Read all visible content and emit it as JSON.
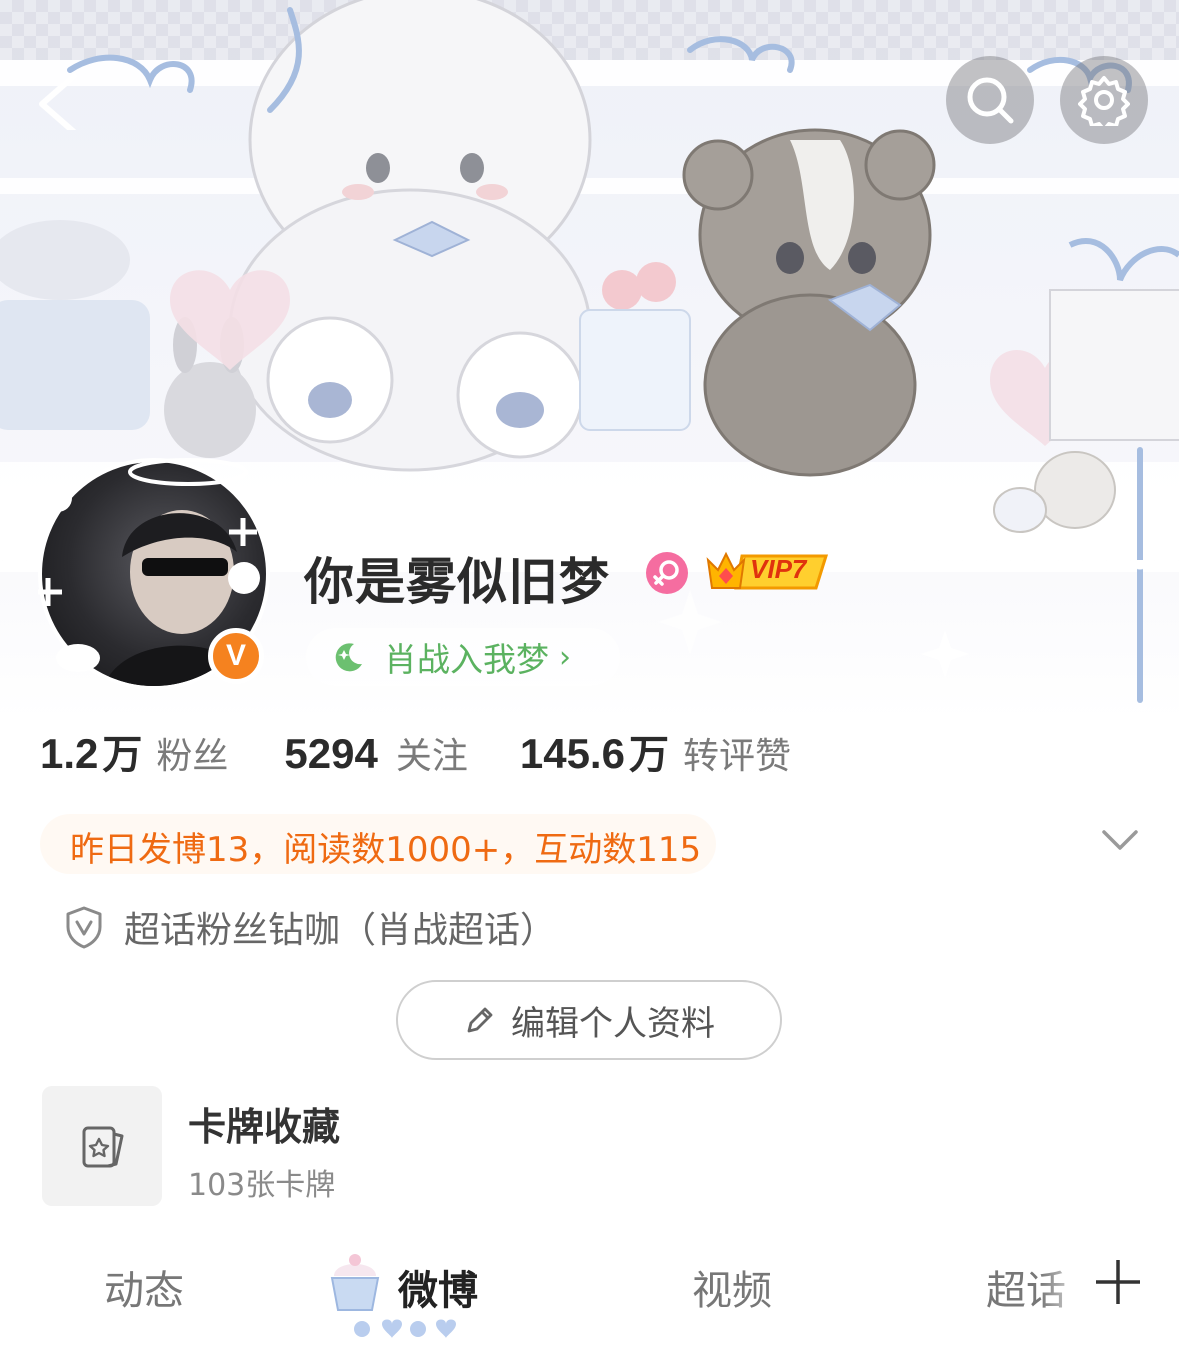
{
  "profile": {
    "username": "你是雾似旧梦",
    "vip_label": "VIP7",
    "verified_mark": "V",
    "supertopic_tag": "肖战入我梦",
    "supertopic_arrow": "›"
  },
  "stats": [
    {
      "number": "1.2",
      "unit": "万",
      "label": "粉丝"
    },
    {
      "number": "5294",
      "unit": "",
      "label": "关注"
    },
    {
      "number": "145.6",
      "unit": "万",
      "label": "转评赞"
    }
  ],
  "activity_summary": "昨日发博13，阅读数1000+，互动数115",
  "honor": "超话粉丝钻咖（肖战超话）",
  "edit_profile_label": "编辑个人资料",
  "card_collection": {
    "title": "卡牌收藏",
    "subtitle": "103张卡牌"
  },
  "tabs": [
    {
      "label": "动态"
    },
    {
      "label": "微博"
    },
    {
      "label": "视频"
    },
    {
      "label": "超话"
    }
  ],
  "active_tab": "微博",
  "colors": {
    "accent_orange": "#ef6a12",
    "tag_green": "#5bb260",
    "verified_orange": "#f5821f",
    "gender_pink": "#f56da0"
  },
  "icons": [
    "back-icon",
    "search-icon",
    "settings-icon",
    "female-icon",
    "vip-crown-icon",
    "moon-icon",
    "chevron-down-icon",
    "shield-v-icon",
    "pencil-icon",
    "card-star-icon",
    "plus-icon"
  ]
}
